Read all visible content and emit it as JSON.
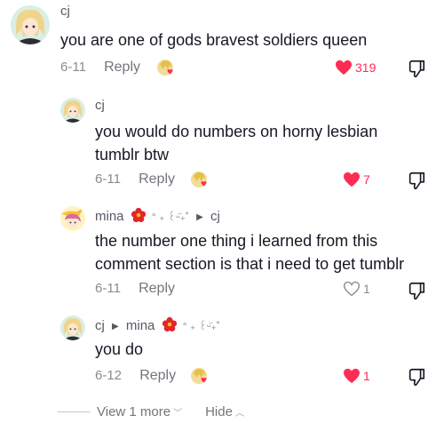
{
  "comments": [
    {
      "username": "cj",
      "text": "you are one of gods bravest soldiers queen",
      "date": "6-11",
      "reply_label": "Reply",
      "likes": "319",
      "liked": true
    },
    {
      "username": "cj",
      "text": "you would do numbers on horny lesbian tumblr btw",
      "date": "6-11",
      "reply_label": "Reply",
      "likes": "7",
      "liked": true
    },
    {
      "username": "mina",
      "decoration": "° ₊ ꒰ᵕ̈₊˚",
      "reply_to": "cj",
      "text": "the number one thing i learned from this comment section is that i need to get tumblr",
      "date": "6-11",
      "reply_label": "Reply",
      "likes": "1",
      "liked": false
    },
    {
      "username": "cj",
      "reply_to": "mina",
      "decoration": "° ₊ ꒰ᵕ̈₊˚",
      "text": "you do",
      "date": "6-12",
      "reply_label": "Reply",
      "likes": "1",
      "liked": true
    }
  ],
  "footer": {
    "view_more_label": "View 1 more",
    "hide_label": "Hide"
  },
  "colors": {
    "like_active": "#fe2c55",
    "muted": "#8a8b91",
    "text": "#161823"
  },
  "icons": {
    "liked": "heart-filled-icon",
    "not_liked": "heart-outline-icon",
    "dislike": "dislike-icon",
    "creator_badge": "creator-liked-badge-icon",
    "reply_arrow": "triangle-right-icon",
    "decoration_flower": "flower-icon"
  }
}
